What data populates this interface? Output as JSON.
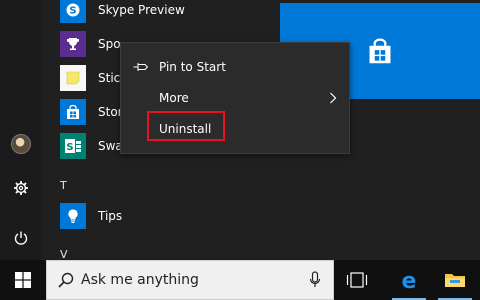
{
  "apps": [
    {
      "label": "Skype Preview",
      "icon": "skype-icon",
      "color": "#0078d7"
    },
    {
      "label": "Spo",
      "icon": "trophy-icon",
      "color": "#5c2d91"
    },
    {
      "label": "Stick",
      "icon": "sticky-note-icon",
      "color": "#ffffff"
    },
    {
      "label": "Stor",
      "icon": "store-bag-icon",
      "color": "#0078d7"
    },
    {
      "label": "Sway",
      "icon": "sway-icon",
      "color": "#008272"
    },
    {
      "label": "Tips",
      "icon": "lightbulb-icon",
      "color": "#0078d7"
    }
  ],
  "sections": {
    "t": "T",
    "v": "V"
  },
  "context_menu": {
    "pin": "Pin to Start",
    "more": "More",
    "uninstall": "Uninstall"
  },
  "search": {
    "placeholder": "Ask me anything"
  },
  "colors": {
    "accent": "#0078d7",
    "highlight_box": "#e81123",
    "taskbar": "#101010",
    "menu_bg": "#2b2b2b"
  }
}
